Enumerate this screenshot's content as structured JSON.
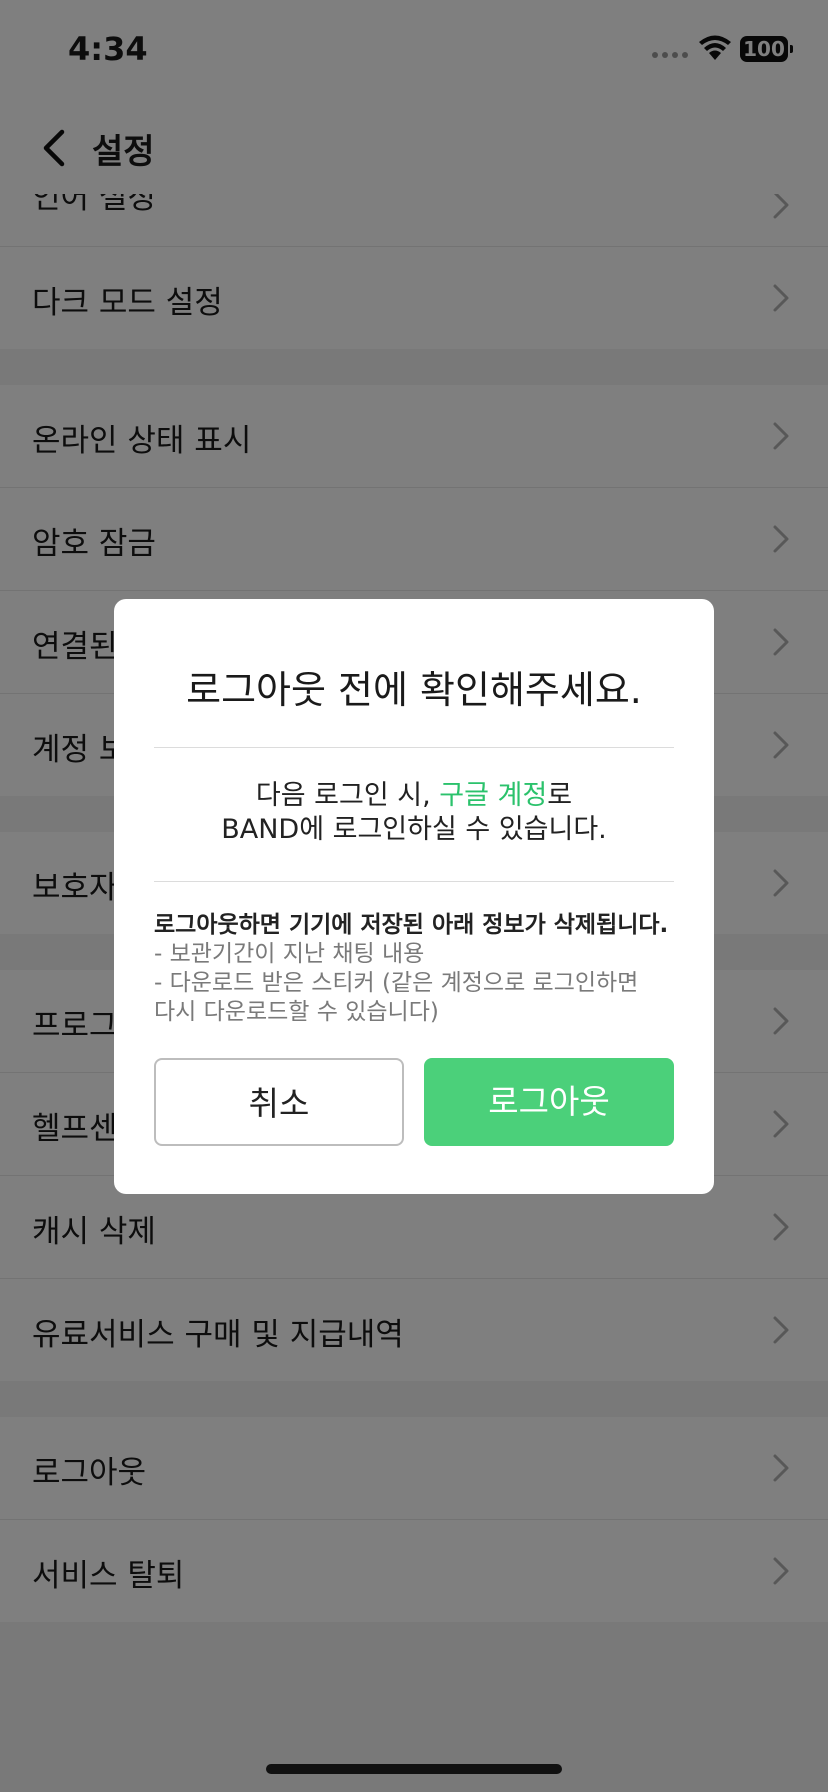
{
  "status_bar": {
    "time": "4:34",
    "battery": "100"
  },
  "nav": {
    "title": "설정"
  },
  "settings": {
    "partial_top_item": "언어 설정",
    "groups": [
      {
        "items": [
          "다크 모드 설정"
        ]
      },
      {
        "items": [
          "온라인 상태 표시",
          "암호 잠금",
          "연결된 기기 관리",
          "계정 보안"
        ]
      },
      {
        "items": [
          "보호자 설정"
        ]
      },
      {
        "items": [
          "프로그램 정보",
          "헬프센터",
          "캐시 삭제",
          "유료서비스 구매 및 지급내역"
        ]
      },
      {
        "items": [
          "로그아웃",
          "서비스 탈퇴"
        ]
      }
    ]
  },
  "dialog": {
    "title": "로그아웃 전에 확인해주세요.",
    "message": {
      "line1_prefix": "다음 로그인 시, ",
      "line1_highlight": "구글 계정",
      "line1_suffix": "로",
      "line2": "BAND에 로그인하실 수 있습니다."
    },
    "warning": {
      "heading": "로그아웃하면 기기에 저장된 아래 정보가 삭제됩니다.",
      "items": [
        "- 보관기간이 지난 채팅 내용",
        "- 다운로드 받은 스티커 (같은 계정으로 로그인하면",
        "다시 다운로드할 수 있습니다)"
      ]
    },
    "cancel_label": "취소",
    "logout_label": "로그아웃"
  },
  "colors": {
    "accent": "#2bc26c",
    "logout_button": "#4bd07a"
  }
}
